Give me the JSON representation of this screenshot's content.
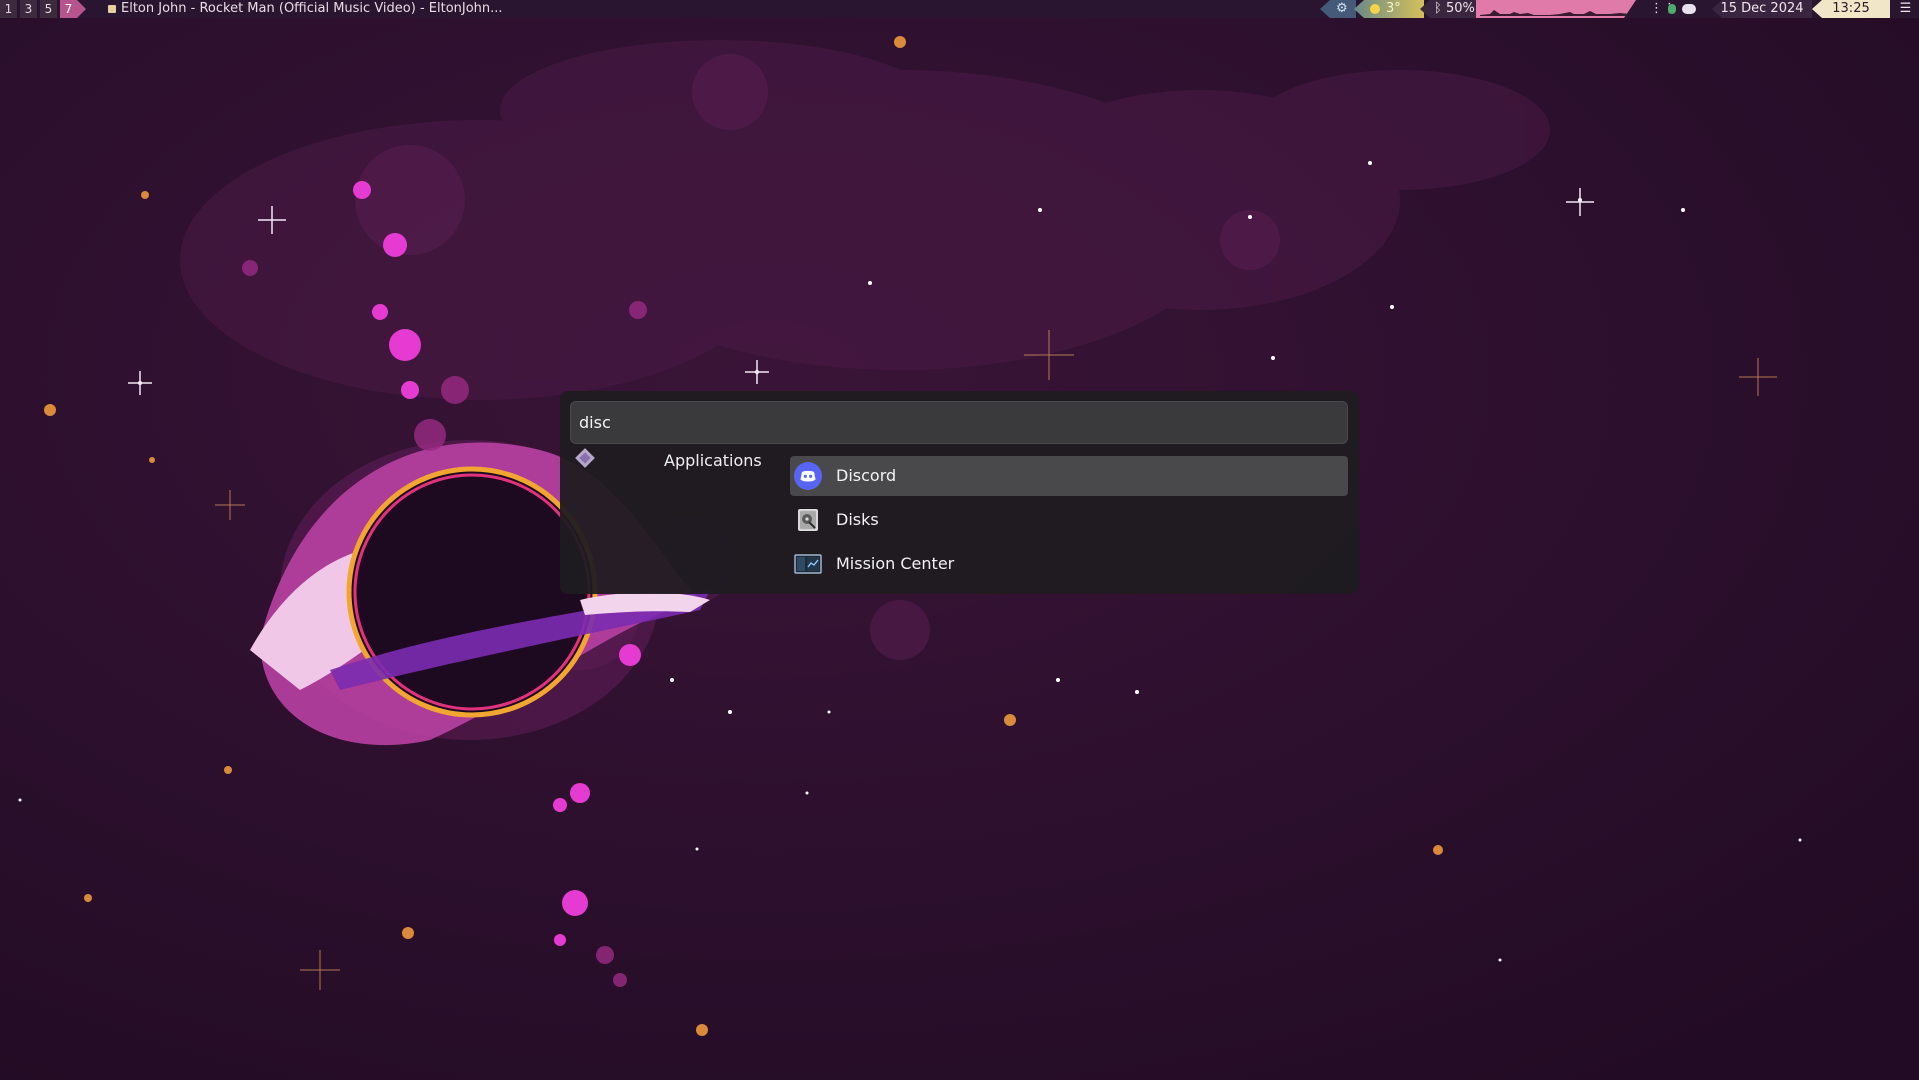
{
  "topbar": {
    "workspaces": [
      "1",
      "3",
      "5",
      "7"
    ],
    "active_workspace": "7",
    "window_title": "Elton John - Rocket Man (Official Music Video) - EltonJohn...",
    "weather": "3°",
    "bluetooth_battery": "50%",
    "date": "15 Dec 2024",
    "time": "13:25"
  },
  "launcher": {
    "query": "disc",
    "category": "Applications",
    "results": [
      {
        "label": "Discord",
        "icon": "discord-icon",
        "selected": true
      },
      {
        "label": "Disks",
        "icon": "disks-icon",
        "selected": false
      },
      {
        "label": "Mission Center",
        "icon": "mission-center-icon",
        "selected": false
      }
    ]
  },
  "colors": {
    "bar_bg": "#2a1530",
    "accent_pink": "#b7548e",
    "launcher_bg": "#1e1c20",
    "selected_row": "#49494b",
    "discord_blue": "#5865f2"
  }
}
